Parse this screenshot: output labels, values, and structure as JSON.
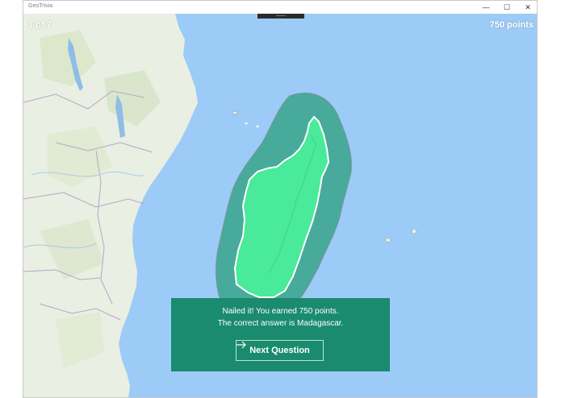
{
  "window": {
    "title": "GeoTrivia",
    "controls": {
      "minimize": "—",
      "maximize": "☐",
      "close": "✕"
    }
  },
  "game": {
    "question_counter": "1 of 7",
    "score": "750 points"
  },
  "result": {
    "message": "Nailed it!  You earned 750 points.",
    "answer": "The correct answer is Madagascar.",
    "next_button_label": "Next Question",
    "next_button_icon": "arrow-right-icon"
  },
  "colors": {
    "ocean": "#9ccbf7",
    "land": "#e9efe2",
    "highlight_zone": "#3aa58c",
    "answer_fill": "#49ea9a",
    "panel": "#1a8b6e"
  }
}
